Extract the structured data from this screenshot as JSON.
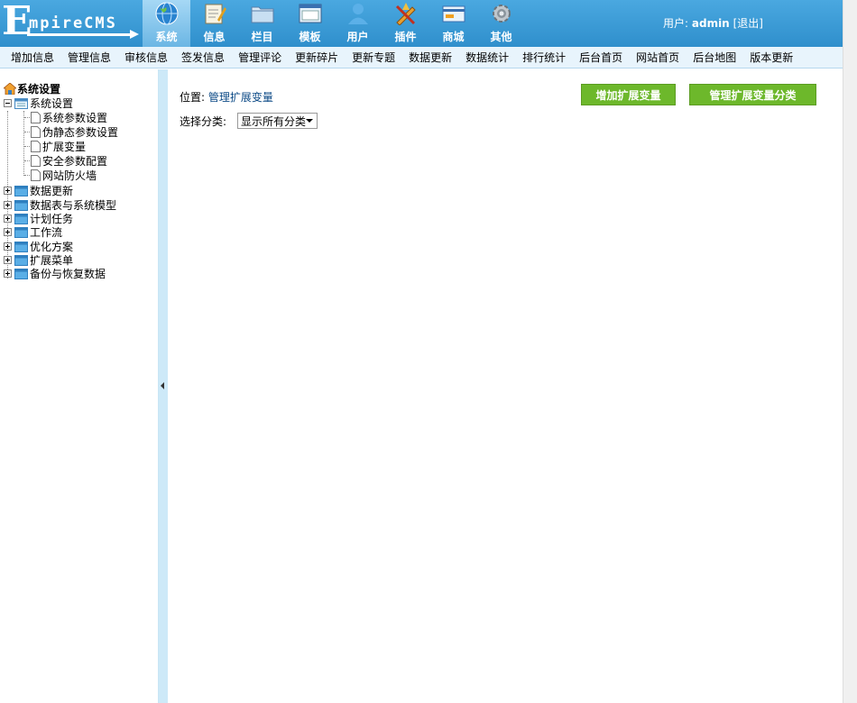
{
  "header": {
    "logo_big": "E",
    "logo_rest": "mpireCMS",
    "nav": [
      {
        "label": "系统",
        "icon": "globe-icon",
        "active": true
      },
      {
        "label": "信息",
        "icon": "notepad-icon",
        "active": false
      },
      {
        "label": "栏目",
        "icon": "folder-icon",
        "active": false
      },
      {
        "label": "模板",
        "icon": "window-icon",
        "active": false
      },
      {
        "label": "用户",
        "icon": "user-icon",
        "active": false
      },
      {
        "label": "插件",
        "icon": "tools-icon",
        "active": false
      },
      {
        "label": "商城",
        "icon": "card-icon",
        "active": false
      },
      {
        "label": "其他",
        "icon": "gear-icon",
        "active": false
      }
    ],
    "user_label": "用户:",
    "username": "admin",
    "logout": "[退出]"
  },
  "subnav": [
    "增加信息",
    "管理信息",
    "审核信息",
    "签发信息",
    "管理评论",
    "更新碎片",
    "更新专题",
    "数据更新",
    "数据统计",
    "排行统计",
    "后台首页",
    "网站首页",
    "后台地图",
    "版本更新"
  ],
  "sidebar": {
    "title": "系统设置",
    "root": "系统设置",
    "children": [
      "系统参数设置",
      "伪静态参数设置",
      "扩展变量",
      "安全参数配置",
      "网站防火墙"
    ],
    "groups": [
      "数据更新",
      "数据表与系统模型",
      "计划任务",
      "工作流",
      "优化方案",
      "扩展菜单",
      "备份与恢复数据"
    ]
  },
  "main": {
    "breadcrumb_prefix": "位置:",
    "breadcrumb_link": "管理扩展变量",
    "add_button": "增加扩展变量",
    "manage_button": "管理扩展变量分类",
    "filter_label": "选择分类:",
    "filter_value": "显示所有分类"
  },
  "colors": {
    "header_blue": "#3c9bd6",
    "button_green": "#6db82b",
    "link_blue": "#0c4a86"
  }
}
